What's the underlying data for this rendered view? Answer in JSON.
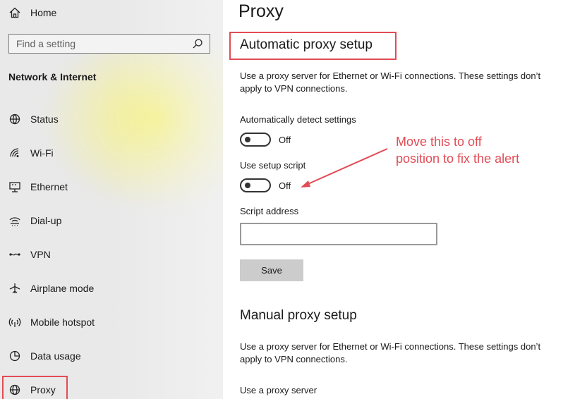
{
  "sidebar": {
    "home_label": "Home",
    "search_placeholder": "Find a setting",
    "section_title": "Network & Internet",
    "items": [
      {
        "label": "Status",
        "icon": "status-icon"
      },
      {
        "label": "Wi-Fi",
        "icon": "wifi-icon"
      },
      {
        "label": "Ethernet",
        "icon": "ethernet-icon"
      },
      {
        "label": "Dial-up",
        "icon": "dialup-icon"
      },
      {
        "label": "VPN",
        "icon": "vpn-icon"
      },
      {
        "label": "Airplane mode",
        "icon": "airplane-icon"
      },
      {
        "label": "Mobile hotspot",
        "icon": "hotspot-icon"
      },
      {
        "label": "Data usage",
        "icon": "data-usage-icon"
      },
      {
        "label": "Proxy",
        "icon": "globe-icon",
        "selected": true
      }
    ]
  },
  "main": {
    "title": "Proxy",
    "automatic": {
      "heading": "Automatic proxy setup",
      "description": "Use a proxy server for Ethernet or Wi-Fi connections. These settings don’t apply to VPN connections.",
      "detect_label": "Automatically detect settings",
      "detect_state": "Off",
      "script_label": "Use setup script",
      "script_state": "Off",
      "address_label": "Script address",
      "address_value": "",
      "save_label": "Save"
    },
    "manual": {
      "heading": "Manual proxy setup",
      "description": "Use a proxy server for Ethernet or Wi-Fi connections. These settings don’t apply to VPN connections.",
      "use_proxy_label": "Use a proxy server"
    }
  },
  "annotation": {
    "text": "Move this to off\nposition to fix the alert",
    "color": "#e24c55"
  }
}
